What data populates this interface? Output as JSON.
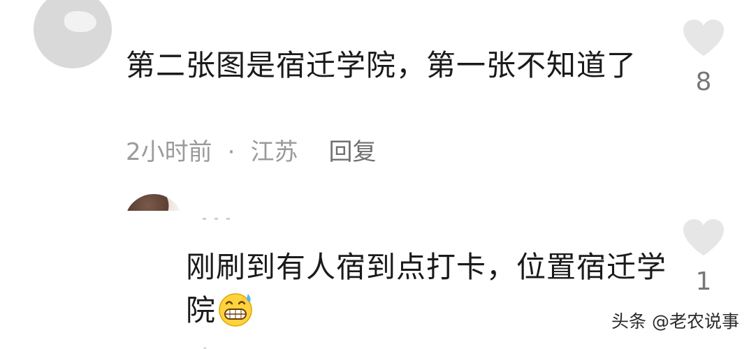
{
  "comments": [
    {
      "text": "第二张图是宿迁学院，第一张不知道了",
      "time": "2小时前",
      "separator": "·",
      "location": "江苏",
      "reply_label": "回复",
      "likes": "8"
    },
    {
      "text": "刚刷到有人宿到点打卡，位置宿迁学院",
      "emoji": "grinning-face-with-sweat",
      "time": "",
      "separator": "·",
      "location": "",
      "reply_label": "",
      "likes": "1"
    }
  ],
  "watermark": "头条 @老农说事",
  "colors": {
    "text": "#1a1a1a",
    "meta": "#9a9a9a",
    "heart": "#e6e6e6",
    "avatar_placeholder": "#d9d9d9"
  },
  "icons": [
    "heart-icon",
    "emoji-sweat-smile"
  ]
}
